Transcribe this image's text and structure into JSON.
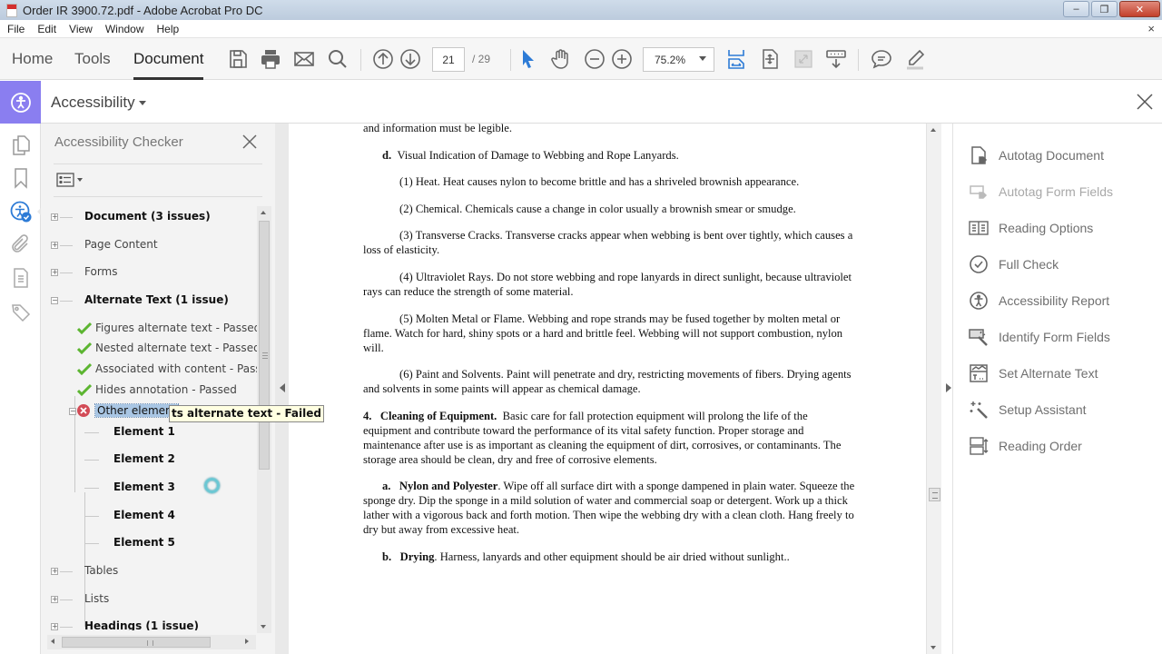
{
  "window": {
    "title": "Order IR 3900.72.pdf - Adobe Acrobat Pro DC",
    "controls": {
      "minimize": "–",
      "restore": "❐",
      "close": "✕"
    }
  },
  "menu": {
    "items": [
      "File",
      "Edit",
      "View",
      "Window",
      "Help"
    ],
    "doc_close": "×"
  },
  "toolbar": {
    "tabs": [
      {
        "label": "Home",
        "active": false
      },
      {
        "label": "Tools",
        "active": false
      },
      {
        "label": "Document",
        "active": true
      }
    ],
    "current_page": "21",
    "total_pages": "/ 29",
    "zoom_level": "75.2%",
    "accent": "#2d7bd6"
  },
  "tool_header": {
    "title": "Accessibility",
    "accent": "#8a7ef0"
  },
  "left_rail": {
    "icons": [
      "page-thumbnails-icon",
      "bookmarks-icon",
      "accessibility-checker-icon",
      "attachments-icon",
      "content-icon",
      "tags-icon"
    ]
  },
  "checker": {
    "title": "Accessibility Checker",
    "tree": [
      {
        "label": "Document (3 issues)",
        "bold": true,
        "expander": "+"
      },
      {
        "label": "Page Content",
        "bold": false,
        "expander": "+"
      },
      {
        "label": "Forms",
        "bold": false,
        "expander": "+"
      },
      {
        "label": "Alternate Text (1 issue)",
        "bold": true,
        "expander": "−"
      },
      {
        "label": "Figures alternate text - Passed",
        "status": "passed"
      },
      {
        "label": "Nested alternate text - Passed",
        "status": "passed"
      },
      {
        "label": "Associated with content - Passed",
        "status": "passed"
      },
      {
        "label": "Hides annotation - Passed",
        "status": "passed"
      },
      {
        "label": "Other elements alternate text - Failed",
        "visible_label": "Other element",
        "status": "failed",
        "expander": "−",
        "selected": true
      },
      {
        "label": "Element 1"
      },
      {
        "label": "Element 2"
      },
      {
        "label": "Element 3"
      },
      {
        "label": "Element 4"
      },
      {
        "label": "Element 5"
      },
      {
        "label": "Tables",
        "bold": false,
        "expander": "+"
      },
      {
        "label": "Lists",
        "bold": false,
        "expander": "+"
      },
      {
        "label": "Headings (1 issue)",
        "bold": true,
        "expander": "+"
      }
    ],
    "tooltip": "ts alternate text - Failed",
    "status_colors": {
      "passed": "#5cb531",
      "failed": "#d24b56"
    }
  },
  "document": {
    "paragraphs": [
      {
        "text": "and information must be legible."
      },
      {
        "lead": "d.",
        "heading": "",
        "text": "Visual Indication of Damage to Webbing and Rope Lanyards."
      },
      {
        "text": "(1)  Heat.  Heat causes nylon to become brittle and has a shriveled brownish appearance."
      },
      {
        "text": "(2)  Chemical.  Chemicals cause a change in color usually a brownish smear or smudge."
      },
      {
        "text": "(3)  Transverse Cracks.  Transverse cracks appear when webbing is bent over tightly, which causes a loss of elasticity."
      },
      {
        "text": "(4)  Ultraviolet Rays.  Do not store webbing and rope lanyards in direct sunlight, because ultraviolet rays can reduce the strength of some material."
      },
      {
        "text": "(5)  Molten Metal or Flame.  Webbing and rope strands may be fused together by molten metal or flame.  Watch for hard, shiny spots or a hard and brittle feel.  Webbing will not support combustion, nylon will."
      },
      {
        "text": "(6)  Paint and Solvents.  Paint will penetrate and dry, restricting movements of fibers. Drying agents and solvents in some paints will appear as chemical damage."
      },
      {
        "lead": "4.",
        "heading": "Cleaning of Equipment.",
        "text": "Basic care for fall protection equipment will prolong the life of the equipment and contribute toward the performance of its vital safety function.  Proper storage and maintenance after use is as important as cleaning the equipment of dirt, corrosives, or contaminants.  The storage area should be clean, dry and free of corrosive elements."
      },
      {
        "lead": "a.",
        "heading": "Nylon and Polyester",
        "text": ".  Wipe off all surface dirt with a sponge dampened in plain water. Squeeze the sponge dry.  Dip the sponge in a mild solution of water and commercial soap or detergent.  Work up a thick lather with a vigorous back and forth motion.  Then wipe the webbing dry with a clean cloth.  Hang freely to dry but away from excessive heat."
      },
      {
        "lead": "b.",
        "heading": "Drying",
        "text": ".  Harness, lanyards and other equipment should be air dried without sunlight.."
      }
    ]
  },
  "right_tools": [
    {
      "label": "Autotag Document",
      "icon": "autotag-document-icon",
      "enabled": true
    },
    {
      "label": "Autotag Form Fields",
      "icon": "autotag-form-fields-icon",
      "enabled": false
    },
    {
      "label": "Reading Options",
      "icon": "reading-options-icon",
      "enabled": true
    },
    {
      "label": "Full Check",
      "icon": "full-check-icon",
      "enabled": true
    },
    {
      "label": "Accessibility Report",
      "icon": "accessibility-report-icon",
      "enabled": true
    },
    {
      "label": "Identify Form Fields",
      "icon": "identify-form-fields-icon",
      "enabled": true
    },
    {
      "label": "Set Alternate Text",
      "icon": "set-alternate-text-icon",
      "enabled": true
    },
    {
      "label": "Setup Assistant",
      "icon": "setup-assistant-icon",
      "enabled": true
    },
    {
      "label": "Reading Order",
      "icon": "reading-order-icon",
      "enabled": true
    }
  ]
}
